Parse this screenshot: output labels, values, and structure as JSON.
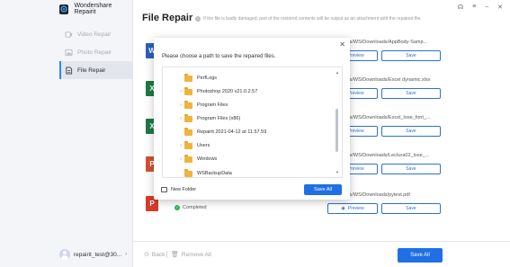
{
  "app": {
    "title": "Wondershare Repairit",
    "brand_color": "#1f6fe5"
  },
  "window_controls": [
    "headset-icon",
    "menu-icon",
    "minimize-icon",
    "close-icon"
  ],
  "sidebar": {
    "items": [
      {
        "label": "Video Repair",
        "icon": "video-icon",
        "active": false
      },
      {
        "label": "Photo Repair",
        "icon": "photo-icon",
        "active": false
      },
      {
        "label": "File Repair",
        "icon": "file-icon",
        "active": true
      }
    ],
    "user": {
      "name": "repairit_test@30..."
    }
  },
  "header": {
    "title": "File Repair",
    "hint": "If the file is badly damaged, part of the restored contents will be output as an attachment with the repaired file."
  },
  "files": [
    {
      "type": "W",
      "color": "#2b5fbf",
      "path": "C:/Users/WS/Downloads/AppBody-Samp..."
    },
    {
      "type": "X",
      "color": "#1e7a44",
      "path": "C:/Users/WS/Downloads/Excel dynamic.xlsx"
    },
    {
      "type": "X",
      "color": "#1e7a44",
      "path": "C:/Users/WS/Downloads/Excel_lose_font_..."
    },
    {
      "type": "P",
      "color": "#d35230",
      "path": "C:/Users/WS/Downloads/Lectura02_lose_..."
    },
    {
      "type": "P",
      "color": "#d93b2b",
      "path": "C:/Users/WS/Downloads/pytest.pdf",
      "status": "Completed"
    }
  ],
  "row_buttons": {
    "preview": "Preview",
    "save": "Save"
  },
  "dialog": {
    "title": "Please choose a path to save the repaired files.",
    "folders": [
      {
        "name": "PerfLogs",
        "expandable": false
      },
      {
        "name": "Photoshop 2020 v21.0.2.57",
        "expandable": true
      },
      {
        "name": "Program Files",
        "expandable": true
      },
      {
        "name": "Program Files (x86)",
        "expandable": true
      },
      {
        "name": "Repairit 2021-04-12 at 11.57.59",
        "expandable": false
      },
      {
        "name": "Users",
        "expandable": true
      },
      {
        "name": "Windows",
        "expandable": true
      },
      {
        "name": "WSBackupData",
        "expandable": false
      }
    ],
    "new_folder": "New Folder",
    "save_all": "Save All"
  },
  "bottom": {
    "back": "Back",
    "remove_all": "Remove All",
    "save_all": "Save All"
  }
}
